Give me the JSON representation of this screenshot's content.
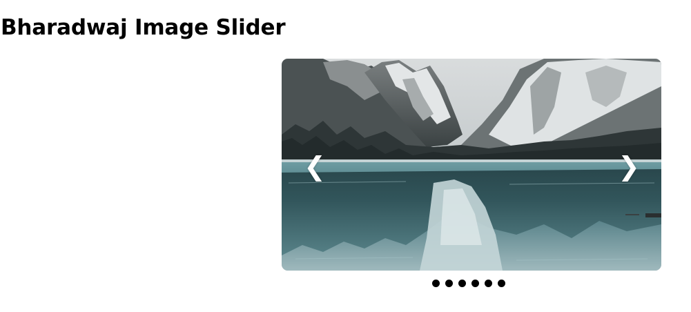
{
  "page": {
    "title": "Bharadwaj Image Slider"
  },
  "slider": {
    "prev_label": "❮",
    "next_label": "❯",
    "current_slide": 1,
    "slide_count": 6,
    "dots": [
      {
        "active": true
      },
      {
        "active": false
      },
      {
        "active": false
      },
      {
        "active": false
      },
      {
        "active": false
      },
      {
        "active": false
      }
    ],
    "image": {
      "subject": "mountain-lake-reflection",
      "colors": {
        "sky": "#cfd4d6",
        "mountain_dark": "#3a3f40",
        "snow": "#e6e9ea",
        "forest": "#2a3233",
        "water": "#5e8e95",
        "water_light": "#9cc3c8"
      }
    }
  }
}
